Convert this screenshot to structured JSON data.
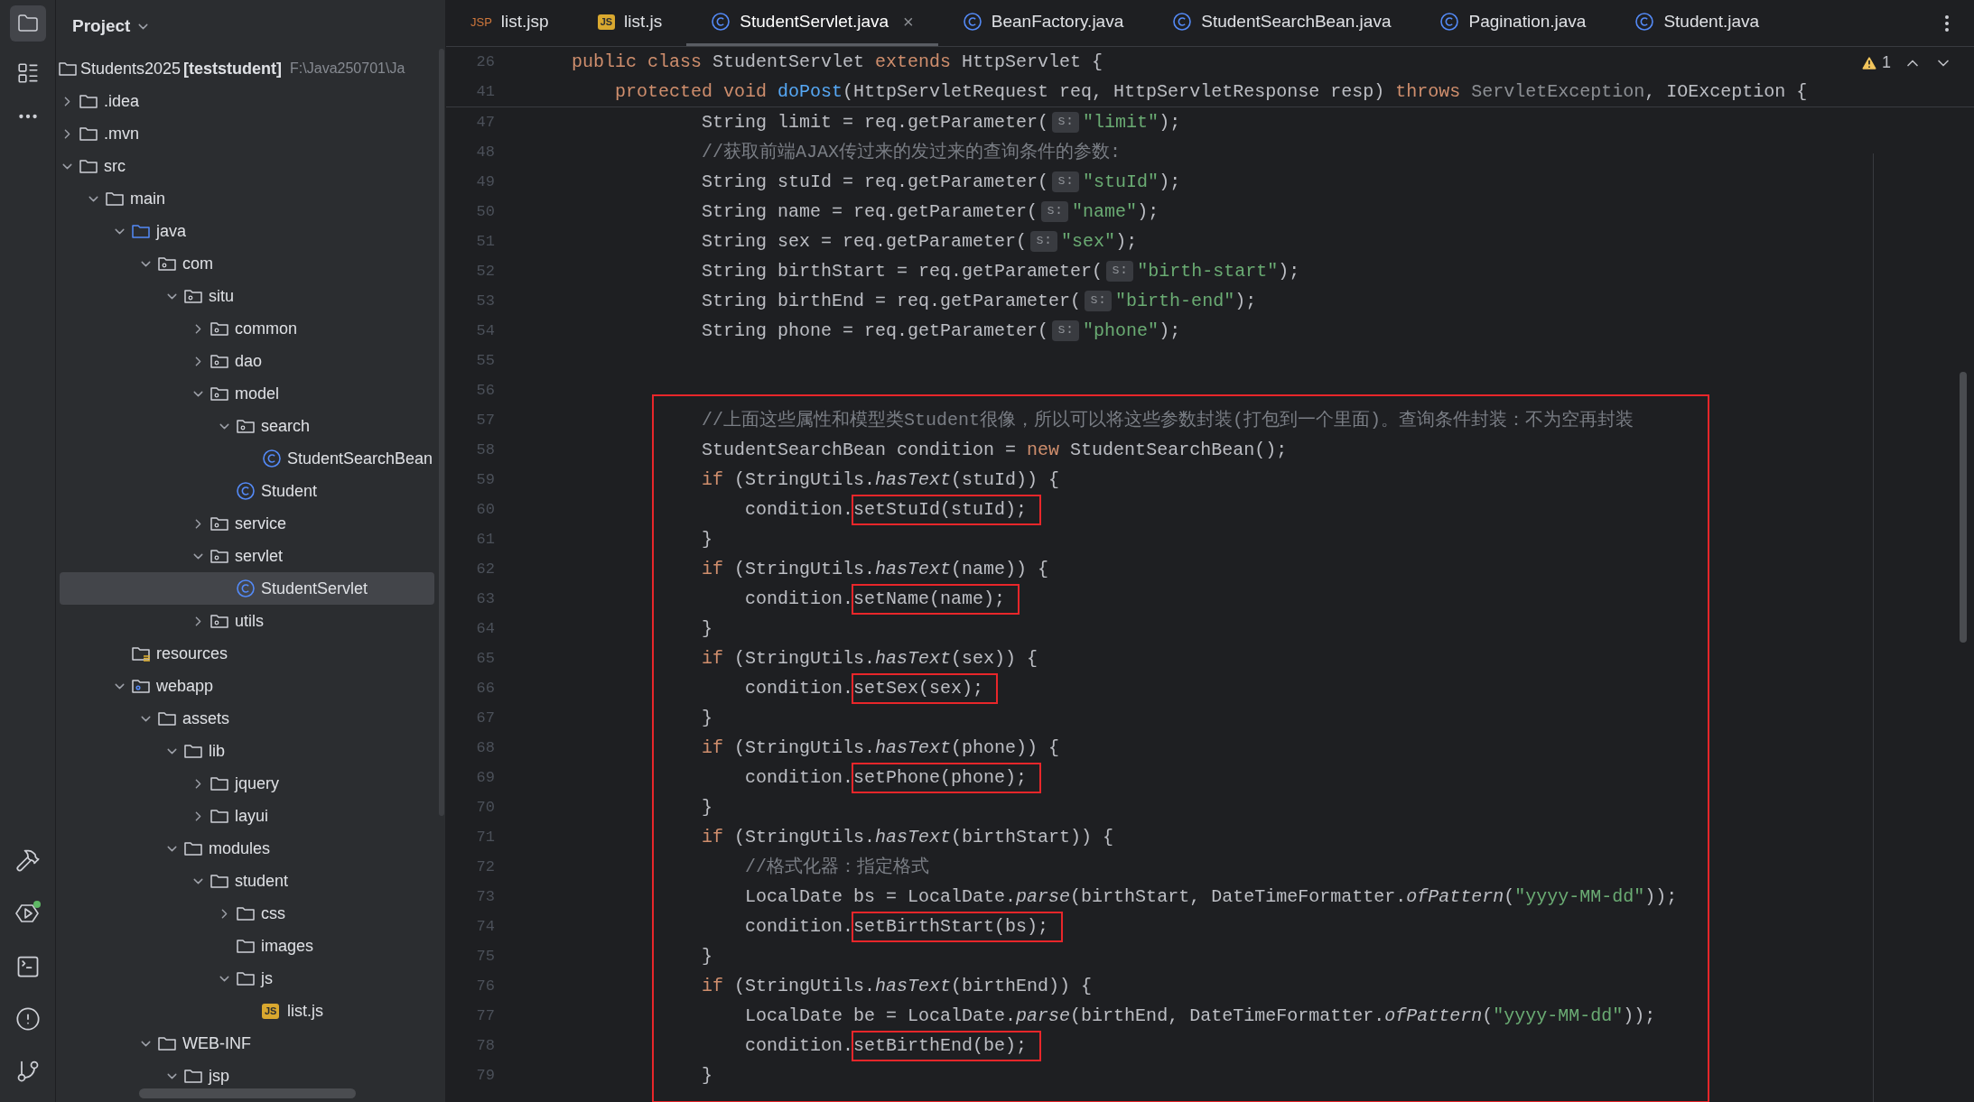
{
  "project_panel": {
    "title": "Project",
    "root": {
      "name": "Students2025",
      "module": "[teststudent]",
      "path": "F:\\Java250701\\Ja",
      "selected": false
    },
    "tree": [
      {
        "name": ".idea",
        "kind": "folder",
        "expanded": false,
        "selected": false
      },
      {
        "name": ".mvn",
        "kind": "folder",
        "expanded": false,
        "selected": false
      },
      {
        "name": "src",
        "kind": "folder",
        "expanded": true,
        "selected": false,
        "children": [
          {
            "name": "main",
            "kind": "folder",
            "expanded": true,
            "selected": false,
            "children": [
              {
                "name": "java",
                "kind": "source",
                "expanded": true,
                "selected": false,
                "children": [
                  {
                    "name": "com",
                    "kind": "package",
                    "expanded": true,
                    "selected": false,
                    "children": [
                      {
                        "name": "situ",
                        "kind": "package",
                        "expanded": true,
                        "selected": false,
                        "children": [
                          {
                            "name": "common",
                            "kind": "package",
                            "expanded": false,
                            "selected": false
                          },
                          {
                            "name": "dao",
                            "kind": "package",
                            "expanded": false,
                            "selected": false
                          },
                          {
                            "name": "model",
                            "kind": "package",
                            "expanded": true,
                            "selected": false,
                            "children": [
                              {
                                "name": "search",
                                "kind": "package",
                                "expanded": true,
                                "selected": false,
                                "children": [
                                  {
                                    "name": "StudentSearchBean",
                                    "kind": "class",
                                    "selected": false
                                  }
                                ]
                              },
                              {
                                "name": "Student",
                                "kind": "class",
                                "selected": false
                              }
                            ]
                          },
                          {
                            "name": "service",
                            "kind": "package",
                            "expanded": false,
                            "selected": false
                          },
                          {
                            "name": "servlet",
                            "kind": "package",
                            "expanded": true,
                            "selected": false,
                            "children": [
                              {
                                "name": "StudentServlet",
                                "kind": "class",
                                "selected": true
                              }
                            ]
                          },
                          {
                            "name": "utils",
                            "kind": "package",
                            "expanded": false,
                            "selected": false
                          }
                        ]
                      }
                    ]
                  }
                ]
              },
              {
                "name": "resources",
                "kind": "resources",
                "selected": false
              },
              {
                "name": "webapp",
                "kind": "web",
                "expanded": true,
                "selected": false,
                "children": [
                  {
                    "name": "assets",
                    "kind": "folder",
                    "expanded": true,
                    "selected": false,
                    "children": [
                      {
                        "name": "lib",
                        "kind": "folder",
                        "expanded": true,
                        "selected": false,
                        "children": [
                          {
                            "name": "jquery",
                            "kind": "folder",
                            "expanded": false,
                            "selected": false
                          },
                          {
                            "name": "layui",
                            "kind": "folder",
                            "expanded": false,
                            "selected": false
                          }
                        ]
                      },
                      {
                        "name": "modules",
                        "kind": "folder",
                        "expanded": true,
                        "selected": false,
                        "children": [
                          {
                            "name": "student",
                            "kind": "folder",
                            "expanded": true,
                            "selected": false,
                            "children": [
                              {
                                "name": "css",
                                "kind": "folder",
                                "expanded": false,
                                "selected": false
                              },
                              {
                                "name": "images",
                                "kind": "folder",
                                "selected": false
                              },
                              {
                                "name": "js",
                                "kind": "folder",
                                "expanded": true,
                                "selected": false,
                                "children": [
                                  {
                                    "name": "list.js",
                                    "kind": "js",
                                    "badge": "JS",
                                    "selected": false
                                  }
                                ]
                              }
                            ]
                          }
                        ]
                      }
                    ]
                  },
                  {
                    "name": "WEB-INF",
                    "kind": "folder",
                    "expanded": true,
                    "selected": false,
                    "children": [
                      {
                        "name": "jsp",
                        "kind": "folder",
                        "expanded": true,
                        "selected": false
                      }
                    ]
                  }
                ]
              }
            ]
          }
        ]
      }
    ]
  },
  "tabs": [
    {
      "label": "list.jsp",
      "kind": "jsp",
      "badge": "JSP",
      "selected": false
    },
    {
      "label": "list.js",
      "kind": "js",
      "badge": "JS",
      "selected": false
    },
    {
      "label": "StudentServlet.java",
      "kind": "class",
      "selected": true,
      "close": "×"
    },
    {
      "label": "BeanFactory.java",
      "kind": "class",
      "selected": false
    },
    {
      "label": "StudentSearchBean.java",
      "kind": "class",
      "selected": false
    },
    {
      "label": "Pagination.java",
      "kind": "class",
      "selected": false
    },
    {
      "label": "Student.java",
      "kind": "class",
      "selected": false
    }
  ],
  "inspections": {
    "warnings": "1"
  },
  "editor": {
    "sticky_lines": [
      {
        "number": "26",
        "tokens": [
          {
            "kind": "keyword",
            "text": "public class"
          },
          {
            "kind": "plain",
            "text": " StudentServlet "
          },
          {
            "kind": "keyword",
            "text": "extends"
          },
          {
            "kind": "plain",
            "text": " HttpServlet {"
          }
        ]
      },
      {
        "number": "41",
        "tokens": [
          {
            "kind": "keyword",
            "text": "    protected void "
          },
          {
            "kind": "method",
            "text": "doPost"
          },
          {
            "kind": "plain",
            "text": "(HttpServletRequest req, HttpServletResponse resp) "
          },
          {
            "kind": "keyword",
            "text": "throws "
          },
          {
            "kind": "gray",
            "text": "ServletException"
          },
          {
            "kind": "plain",
            "text": ", IOException {"
          }
        ]
      }
    ],
    "lines": [
      {
        "number": "47",
        "tokens": [
          {
            "kind": "plain",
            "text": "            String limit = req.getParameter("
          },
          {
            "kind": "hint",
            "text": "s:"
          },
          {
            "kind": "string",
            "text": "\"limit\""
          },
          {
            "kind": "plain",
            "text": ");"
          }
        ]
      },
      {
        "number": "48",
        "tokens": [
          {
            "kind": "comment",
            "text": "            //获取前端AJAX传过来的发过来的查询条件的参数:"
          }
        ]
      },
      {
        "number": "49",
        "tokens": [
          {
            "kind": "plain",
            "text": "            String stuId = req.getParameter("
          },
          {
            "kind": "hint",
            "text": "s:"
          },
          {
            "kind": "string",
            "text": "\"stuId\""
          },
          {
            "kind": "plain",
            "text": ");"
          }
        ]
      },
      {
        "number": "50",
        "tokens": [
          {
            "kind": "plain",
            "text": "            String name = req.getParameter("
          },
          {
            "kind": "hint",
            "text": "s:"
          },
          {
            "kind": "string",
            "text": "\"name\""
          },
          {
            "kind": "plain",
            "text": ");"
          }
        ]
      },
      {
        "number": "51",
        "tokens": [
          {
            "kind": "plain",
            "text": "            String sex = req.getParameter("
          },
          {
            "kind": "hint",
            "text": "s:"
          },
          {
            "kind": "string",
            "text": "\"sex\""
          },
          {
            "kind": "plain",
            "text": ");"
          }
        ]
      },
      {
        "number": "52",
        "tokens": [
          {
            "kind": "plain",
            "text": "            String birthStart = req.getParameter("
          },
          {
            "kind": "hint",
            "text": "s:"
          },
          {
            "kind": "string",
            "text": "\"birth-start\""
          },
          {
            "kind": "plain",
            "text": ");"
          }
        ]
      },
      {
        "number": "53",
        "tokens": [
          {
            "kind": "plain",
            "text": "            String birthEnd = req.getParameter("
          },
          {
            "kind": "hint",
            "text": "s:"
          },
          {
            "kind": "string",
            "text": "\"birth-end\""
          },
          {
            "kind": "plain",
            "text": ");"
          }
        ]
      },
      {
        "number": "54",
        "tokens": [
          {
            "kind": "plain",
            "text": "            String phone = req.getParameter("
          },
          {
            "kind": "hint",
            "text": "s:"
          },
          {
            "kind": "string",
            "text": "\"phone\""
          },
          {
            "kind": "plain",
            "text": ");"
          }
        ]
      },
      {
        "number": "55"
      },
      {
        "number": "56"
      }
    ],
    "highlighted_lines": [
      {
        "number": "57",
        "tokens": [
          {
            "kind": "comment",
            "text": "            //上面这些属性和模型类Student很像，所以可以将这些参数封装(打包到一个里面)。查询条件封装：不为空再封装"
          }
        ]
      },
      {
        "number": "58",
        "tokens": [
          {
            "kind": "plain",
            "text": "            StudentSearchBean condition = "
          },
          {
            "kind": "keyword",
            "text": "new"
          },
          {
            "kind": "plain",
            "text": " StudentSearchBean();"
          }
        ]
      },
      {
        "number": "59",
        "tokens": [
          {
            "kind": "keyword",
            "text": "            if"
          },
          {
            "kind": "plain",
            "text": " (StringUtils."
          },
          {
            "kind": "italic",
            "text": "hasText"
          },
          {
            "kind": "plain",
            "text": "(stuId)) {"
          }
        ]
      },
      {
        "number": "60",
        "tokens": [
          {
            "kind": "plain",
            "text": "                condition."
          },
          {
            "kind": "boxed",
            "text": "setStuId(stuId);"
          }
        ]
      },
      {
        "number": "61",
        "tokens": [
          {
            "kind": "plain",
            "text": "            }"
          }
        ]
      },
      {
        "number": "62",
        "tokens": [
          {
            "kind": "keyword",
            "text": "            if"
          },
          {
            "kind": "plain",
            "text": " (StringUtils."
          },
          {
            "kind": "italic",
            "text": "hasText"
          },
          {
            "kind": "plain",
            "text": "(name)) {"
          }
        ]
      },
      {
        "number": "63",
        "tokens": [
          {
            "kind": "plain",
            "text": "                condition."
          },
          {
            "kind": "boxed",
            "text": "setName(name);"
          }
        ]
      },
      {
        "number": "64",
        "tokens": [
          {
            "kind": "plain",
            "text": "            }"
          }
        ]
      },
      {
        "number": "65",
        "tokens": [
          {
            "kind": "keyword",
            "text": "            if"
          },
          {
            "kind": "plain",
            "text": " (StringUtils."
          },
          {
            "kind": "italic",
            "text": "hasText"
          },
          {
            "kind": "plain",
            "text": "(sex)) {"
          }
        ]
      },
      {
        "number": "66",
        "tokens": [
          {
            "kind": "plain",
            "text": "                condition."
          },
          {
            "kind": "boxed",
            "text": "setSex(sex);"
          }
        ]
      },
      {
        "number": "67",
        "tokens": [
          {
            "kind": "plain",
            "text": "            }"
          }
        ]
      },
      {
        "number": "68",
        "tokens": [
          {
            "kind": "keyword",
            "text": "            if"
          },
          {
            "kind": "plain",
            "text": " (StringUtils."
          },
          {
            "kind": "italic",
            "text": "hasText"
          },
          {
            "kind": "plain",
            "text": "(phone)) {"
          }
        ]
      },
      {
        "number": "69",
        "tokens": [
          {
            "kind": "plain",
            "text": "                condition."
          },
          {
            "kind": "boxed",
            "text": "setPhone(phone);"
          }
        ]
      },
      {
        "number": "70",
        "tokens": [
          {
            "kind": "plain",
            "text": "            }"
          }
        ]
      },
      {
        "number": "71",
        "tokens": [
          {
            "kind": "keyword",
            "text": "            if"
          },
          {
            "kind": "plain",
            "text": " (StringUtils."
          },
          {
            "kind": "italic",
            "text": "hasText"
          },
          {
            "kind": "plain",
            "text": "(birthStart)) {"
          }
        ]
      },
      {
        "number": "72",
        "tokens": [
          {
            "kind": "comment",
            "text": "                //格式化器：指定格式"
          }
        ]
      },
      {
        "number": "73",
        "tokens": [
          {
            "kind": "plain",
            "text": "                LocalDate bs = LocalDate."
          },
          {
            "kind": "italic",
            "text": "parse"
          },
          {
            "kind": "plain",
            "text": "(birthStart, DateTimeFormatter."
          },
          {
            "kind": "italic",
            "text": "ofPattern"
          },
          {
            "kind": "plain",
            "text": "("
          },
          {
            "kind": "string",
            "text": "\"yyyy-MM-dd\""
          },
          {
            "kind": "plain",
            "text": "));"
          }
        ]
      },
      {
        "number": "74",
        "tokens": [
          {
            "kind": "plain",
            "text": "                condition."
          },
          {
            "kind": "boxed",
            "text": "setBirthStart(bs);"
          }
        ]
      },
      {
        "number": "75",
        "tokens": [
          {
            "kind": "plain",
            "text": "            }"
          }
        ]
      },
      {
        "number": "76",
        "tokens": [
          {
            "kind": "keyword",
            "text": "            if"
          },
          {
            "kind": "plain",
            "text": " (StringUtils."
          },
          {
            "kind": "italic",
            "text": "hasText"
          },
          {
            "kind": "plain",
            "text": "(birthEnd)) {"
          }
        ]
      },
      {
        "number": "77",
        "tokens": [
          {
            "kind": "plain",
            "text": "                LocalDate be = LocalDate."
          },
          {
            "kind": "italic",
            "text": "parse"
          },
          {
            "kind": "plain",
            "text": "(birthEnd, DateTimeFormatter."
          },
          {
            "kind": "italic",
            "text": "ofPattern"
          },
          {
            "kind": "plain",
            "text": "("
          },
          {
            "kind": "string",
            "text": "\"yyyy-MM-dd\""
          },
          {
            "kind": "plain",
            "text": "));"
          }
        ]
      },
      {
        "number": "78",
        "tokens": [
          {
            "kind": "plain",
            "text": "                condition."
          },
          {
            "kind": "boxed",
            "text": "setBirthEnd(be);"
          }
        ]
      },
      {
        "number": "79",
        "tokens": [
          {
            "kind": "plain",
            "text": "            }"
          }
        ]
      }
    ]
  }
}
